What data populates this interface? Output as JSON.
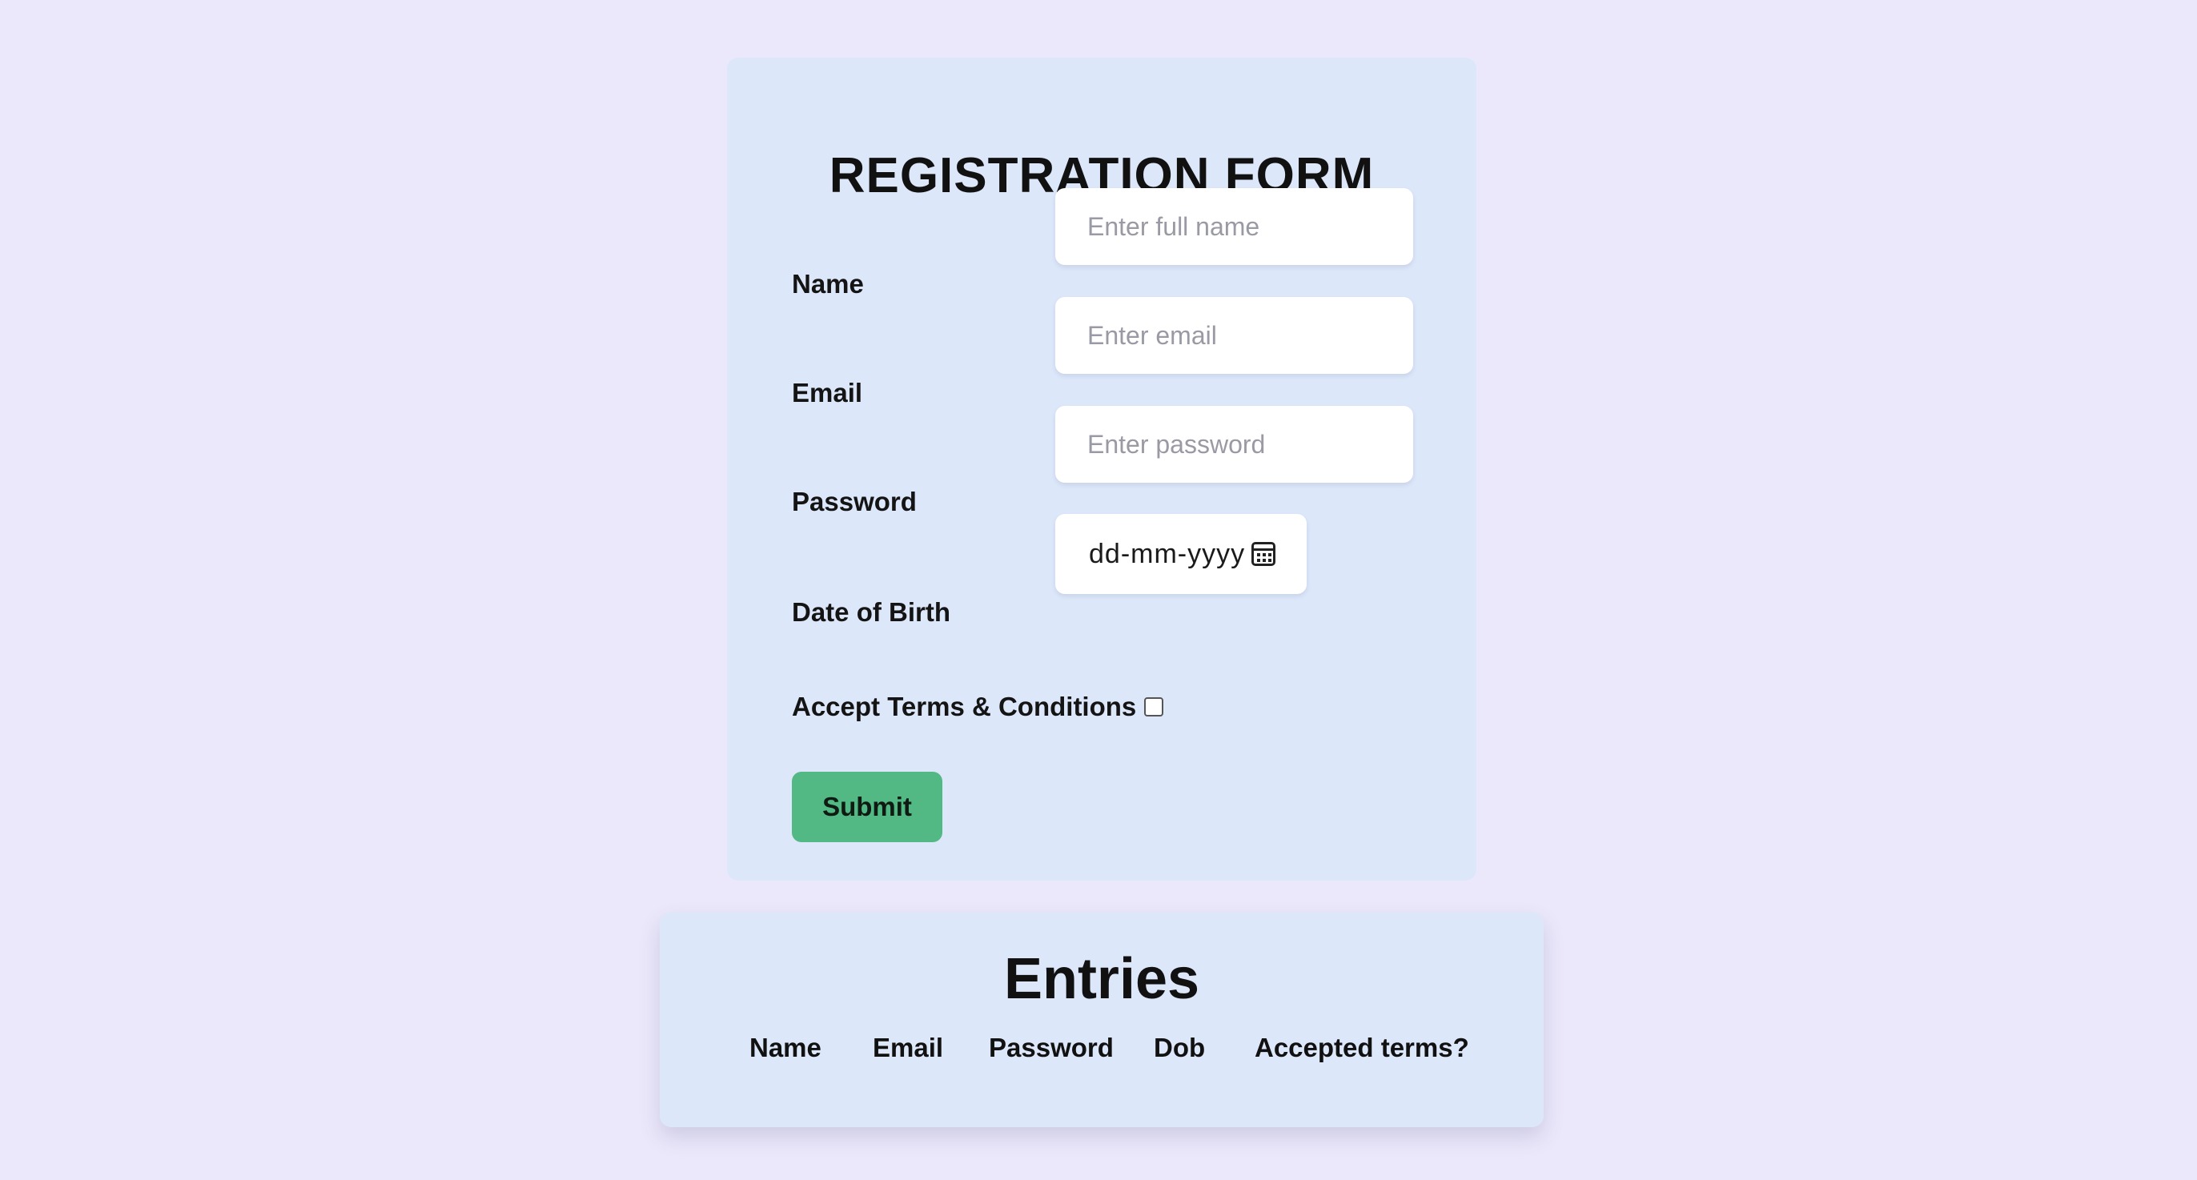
{
  "form": {
    "title": "REGISTRATION FORM",
    "name_label": "Name",
    "name_placeholder": "Enter full name",
    "email_label": "Email",
    "email_placeholder": "Enter email",
    "password_label": "Password",
    "password_placeholder": "Enter password",
    "dob_label": "Date of Birth",
    "dob_placeholder": "dd-mm-yyyy",
    "terms_label": "Accept Terms & Conditions",
    "terms_checked": false,
    "submit_label": "Submit"
  },
  "entries": {
    "title": "Entries",
    "columns": [
      "Name",
      "Email",
      "Password",
      "Dob",
      "Accepted terms?"
    ]
  },
  "colors": {
    "page_background": "#ebe8fb",
    "card_background": "#dde7fa",
    "submit_button": "#52b884"
  }
}
